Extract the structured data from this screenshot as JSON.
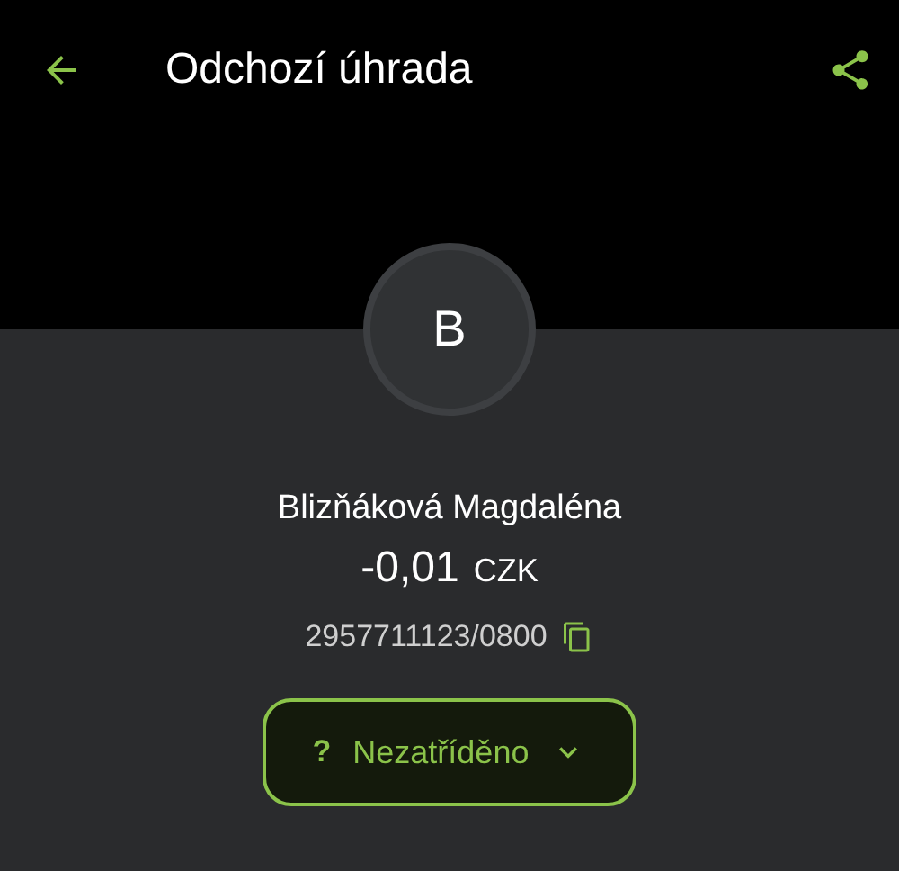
{
  "top_bar": {
    "title": "Odchozí úhrada"
  },
  "counterparty": {
    "initial": "B",
    "name": "Blizňáková Magdaléna",
    "amount": "-0,01",
    "currency": "CZK",
    "account": "2957711123/0800"
  },
  "category_button": {
    "icon": "?",
    "label": "Nezatříděno"
  }
}
